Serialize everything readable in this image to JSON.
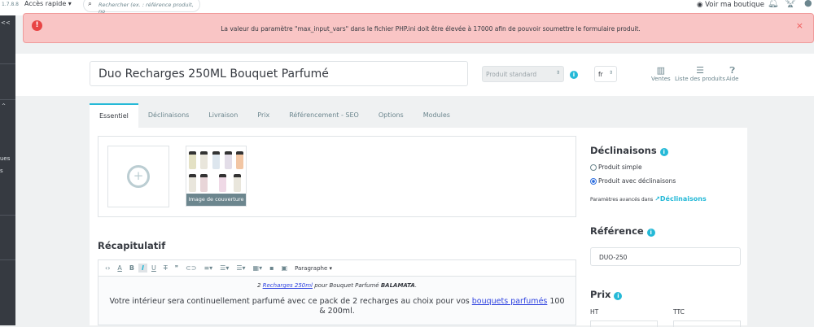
{
  "topbar": {
    "version": "1.7.8.8",
    "quick_access": "Accès rapide",
    "search_placeholder": "Rechercher (ex. : référence produit, no",
    "view_shop": "Voir ma boutique"
  },
  "sidebar": {
    "collapse": "<<",
    "frag1": "ues",
    "frag2": "s"
  },
  "alert": {
    "message": "La valeur du paramètre \"max_input_vars\" dans le fichier PHP.ini doit être élevée à 17000 afin de pouvoir soumettre le formulaire produit.",
    "close": "×"
  },
  "header": {
    "product_name": "Duo Recharges 250ML Bouquet Parfumé",
    "product_type": "Produit standard",
    "lang": "fr",
    "sales": "Ventes",
    "product_list": "Liste des produits",
    "help": "Aide"
  },
  "tabs": [
    "Essentiel",
    "Déclinaisons",
    "Livraison",
    "Prix",
    "Référencement - SEO",
    "Options",
    "Modules"
  ],
  "images": {
    "cover_label": "Image de couverture"
  },
  "summary": {
    "title": "Récapitulatif",
    "format": "Paragraphe",
    "line1_prefix": "2 ",
    "line1_link": "Recharges 250ml",
    "line1_mid": " pour Bouquet Parfumé ",
    "line1_bold": "BALAMATA",
    "line1_end": ".",
    "line2_prefix": "Votre intérieur sera continuellement parfumé avec ce pack de 2 recharges au choix pour vos ",
    "line2_link": "bouquets parfumés",
    "line2_end": " 100 & 200ml."
  },
  "right": {
    "combinations_title": "Déclinaisons",
    "option_simple": "Produit simple",
    "option_combinations": "Produit avec déclinaisons",
    "advanced_prefix": "Paramètres avancés dans",
    "advanced_link": "Déclinaisons",
    "reference_title": "Référence",
    "reference_value": "DUO-250",
    "price_title": "Prix",
    "ht": "HT",
    "ttc": "TTC"
  }
}
